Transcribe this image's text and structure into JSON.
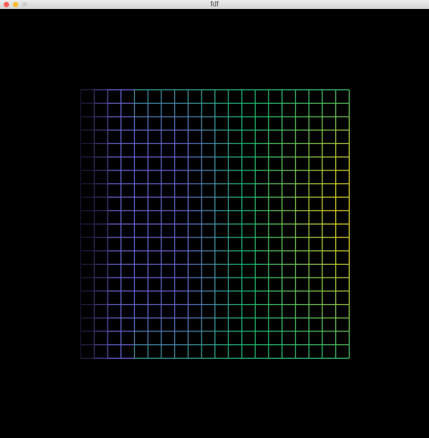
{
  "window": {
    "title": "fdf"
  },
  "wireframe": {
    "cols": 20,
    "rows": 20,
    "colors": {
      "background": "#000000",
      "dark": "#1a0f2a",
      "blue": "#6a68d8",
      "green": "#1ec57b",
      "yellow": "#e6dc2e"
    }
  }
}
